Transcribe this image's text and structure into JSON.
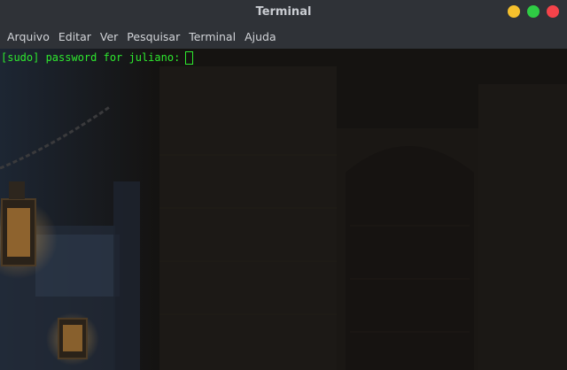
{
  "window": {
    "title": "Terminal"
  },
  "menu": {
    "items": [
      {
        "label": "Arquivo"
      },
      {
        "label": "Editar"
      },
      {
        "label": "Ver"
      },
      {
        "label": "Pesquisar"
      },
      {
        "label": "Terminal"
      },
      {
        "label": "Ajuda"
      }
    ]
  },
  "terminal": {
    "prompt": "[sudo] password for juliano:",
    "text_color": "#2ee82e"
  },
  "controls": {
    "minimize_color": "#f5c02d",
    "maximize_color": "#2fcc44",
    "close_color": "#f5434a"
  }
}
